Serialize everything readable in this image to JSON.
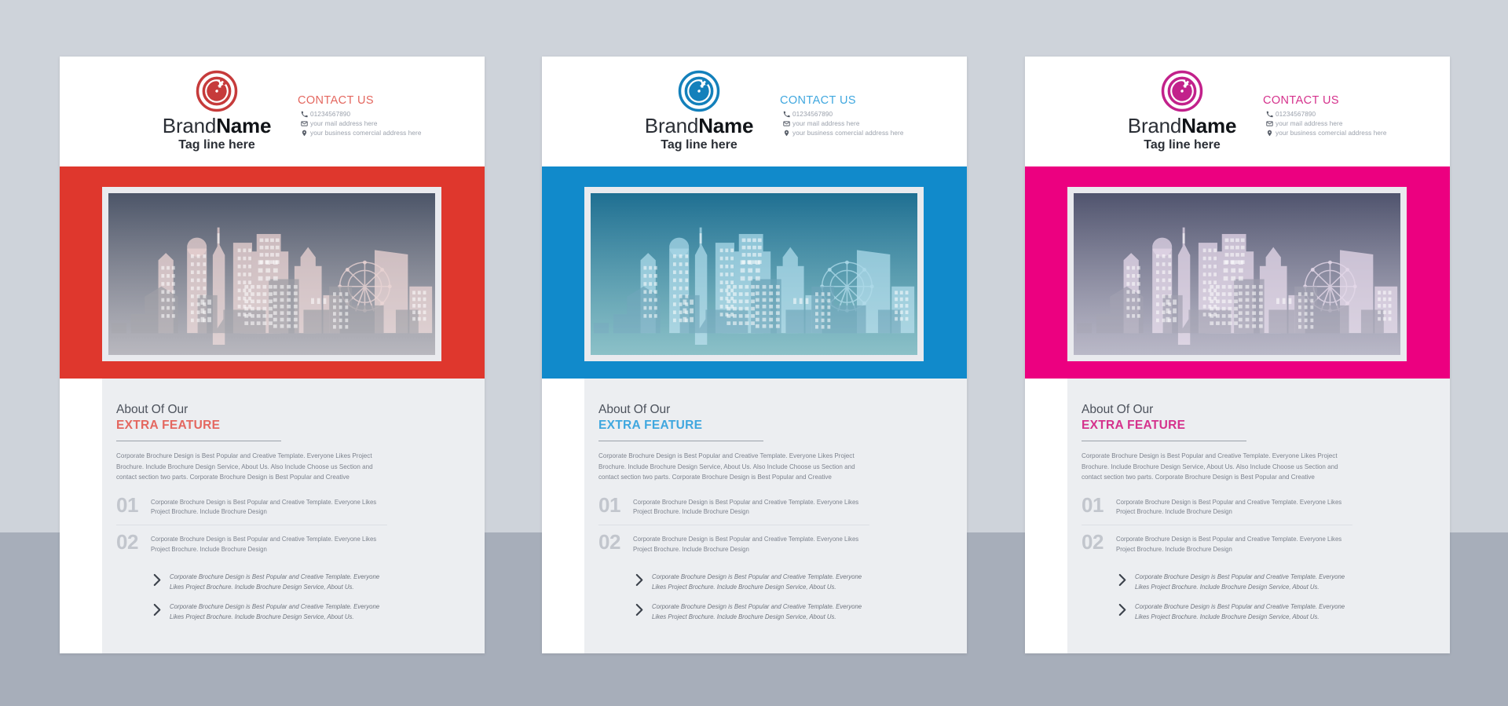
{
  "page": {
    "background_top": "#ced3da",
    "background_bottom": "#a7aeba"
  },
  "flyers": [
    {
      "id": "flyer-red",
      "accent": "#DF372D",
      "accent_soft": "#E4675F",
      "logo_color": "#C63B3B",
      "hero_top": "#4c5568",
      "hero_bottom": "#9a99a3",
      "hero_building": "#e4cbcb",
      "hero_building_dark": "#8a8a93",
      "brand": {
        "first": "Brand",
        "second": "Name",
        "tagline": "Tag line here"
      },
      "contact": {
        "title": "CONTACT US",
        "phone": "01234567890",
        "email": "your mail address here",
        "address": "your business comercial address here",
        "phone_icon": "phone-icon",
        "email_icon": "envelope-icon",
        "address_icon": "location-pin-icon"
      },
      "about": {
        "subtitle": "About Of Our",
        "title": "EXTRA FEATURE",
        "paragraph": "Corporate Brochure Design is Best Popular and Creative Template. Everyone Likes Project Brochure. Include Brochure Design Service, About Us. Also Include Choose us Section and contact section two parts. Corporate Brochure Design is Best Popular and Creative"
      },
      "numbered": [
        {
          "num": "01",
          "text": "Corporate Brochure Design is Best Popular and Creative Template. Everyone Likes Project Brochure. Include Brochure Design"
        },
        {
          "num": "02",
          "text": "Corporate Brochure Design is Best Popular and Creative Template. Everyone Likes Project Brochure. Include Brochure Design"
        }
      ],
      "bullets": [
        "Corporate Brochure Design is Best Popular and Creative Template. Everyone Likes Project Brochure. Include Brochure Design Service, About Us.",
        "Corporate Brochure Design is Best Popular and Creative Template. Everyone Likes Project Brochure. Include Brochure Design Service, About Us."
      ]
    },
    {
      "id": "flyer-blue",
      "accent": "#118ACB",
      "accent_soft": "#3FA7DF",
      "logo_color": "#1380BB",
      "hero_top": "#1f6f92",
      "hero_bottom": "#5aa6b0",
      "hero_building": "#9dd2e4",
      "hero_building_dark": "#4d92ab",
      "brand": {
        "first": "Brand",
        "second": "Name",
        "tagline": "Tag line here"
      },
      "contact": {
        "title": "CONTACT US",
        "phone": "01234567890",
        "email": "your mail address here",
        "address": "your business comercial address here",
        "phone_icon": "phone-icon",
        "email_icon": "envelope-icon",
        "address_icon": "location-pin-icon"
      },
      "about": {
        "subtitle": "About Of Our",
        "title": "EXTRA FEATURE",
        "paragraph": "Corporate Brochure Design is Best Popular and Creative Template. Everyone Likes Project Brochure. Include Brochure Design Service, About Us. Also Include Choose us Section and contact section two parts. Corporate Brochure Design is Best Popular and Creative"
      },
      "numbered": [
        {
          "num": "01",
          "text": "Corporate Brochure Design is Best Popular and Creative Template. Everyone Likes Project Brochure. Include Brochure Design"
        },
        {
          "num": "02",
          "text": "Corporate Brochure Design is Best Popular and Creative Template. Everyone Likes Project Brochure. Include Brochure Design"
        }
      ],
      "bullets": [
        "Corporate Brochure Design is Best Popular and Creative Template. Everyone Likes Project Brochure. Include Brochure Design Service, About Us.",
        "Corporate Brochure Design is Best Popular and Creative Template. Everyone Likes Project Brochure. Include Brochure Design Service, About Us."
      ]
    },
    {
      "id": "flyer-pink",
      "accent": "#EC0080",
      "accent_soft": "#D5318C",
      "logo_color": "#C2218B",
      "hero_top": "#50546e",
      "hero_bottom": "#9c9ab0",
      "hero_building": "#ded0e4",
      "hero_building_dark": "#8b8a9e",
      "brand": {
        "first": "Brand",
        "second": "Name",
        "tagline": "Tag line here"
      },
      "contact": {
        "title": "CONTACT US",
        "phone": "01234567890",
        "email": "your mail address here",
        "address": "your business comercial address here",
        "phone_icon": "phone-icon",
        "email_icon": "envelope-icon",
        "address_icon": "location-pin-icon"
      },
      "about": {
        "subtitle": "About Of Our",
        "title": "EXTRA FEATURE",
        "paragraph": "Corporate Brochure Design is Best Popular and Creative Template. Everyone Likes Project Brochure. Include Brochure Design Service, About Us. Also Include Choose us Section and contact section two parts. Corporate Brochure Design is Best Popular and Creative"
      },
      "numbered": [
        {
          "num": "01",
          "text": "Corporate Brochure Design is Best Popular and Creative Template. Everyone Likes Project Brochure. Include Brochure Design"
        },
        {
          "num": "02",
          "text": "Corporate Brochure Design is Best Popular and Creative Template. Everyone Likes Project Brochure. Include Brochure Design"
        }
      ],
      "bullets": [
        "Corporate Brochure Design is Best Popular and Creative Template. Everyone Likes Project Brochure. Include Brochure Design Service, About Us.",
        "Corporate Brochure Design is Best Popular and Creative Template. Everyone Likes Project Brochure. Include Brochure Design Service, About Us."
      ]
    }
  ]
}
